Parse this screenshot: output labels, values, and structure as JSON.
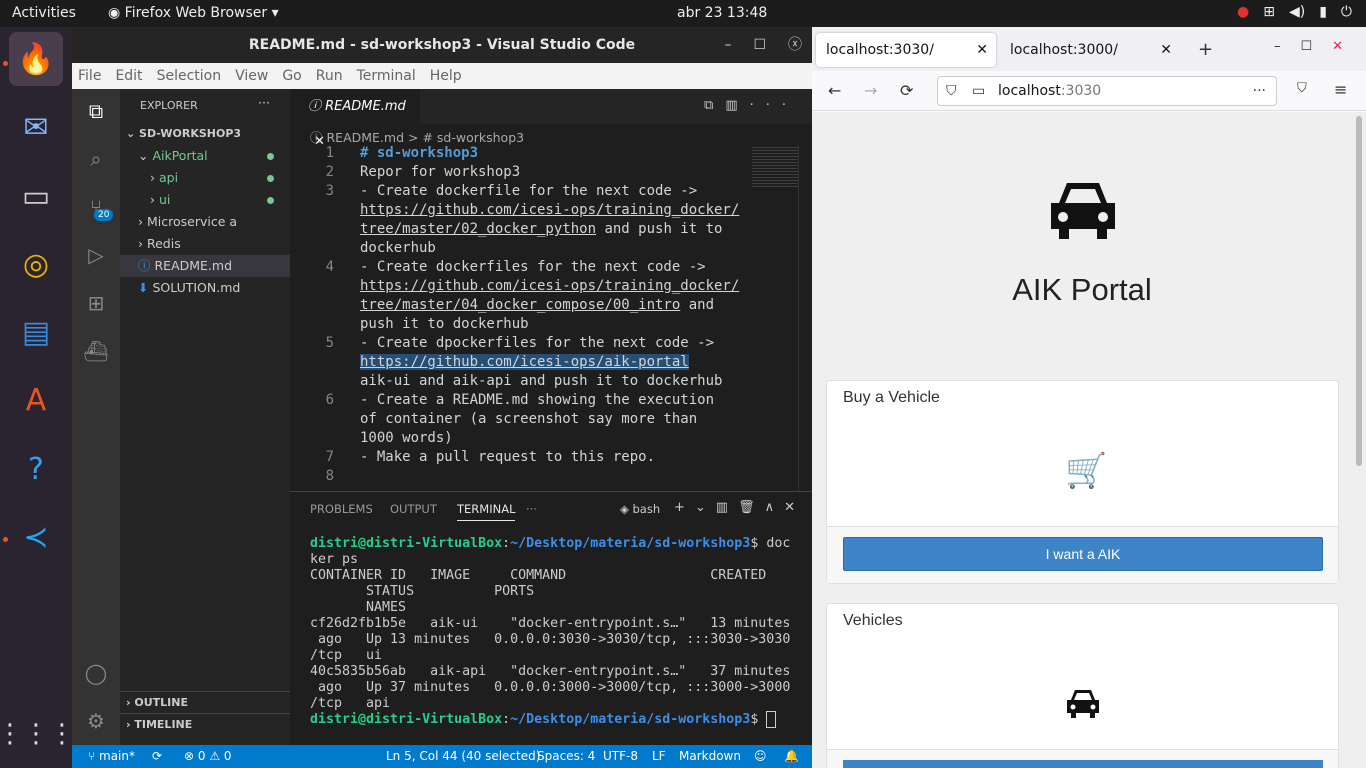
{
  "topbar": {
    "activities": "Activities",
    "app": "Firefox Web Browser",
    "clock": "abr 23  13:48"
  },
  "vscode": {
    "title": "README.md - sd-workshop3 - Visual Studio Code",
    "menu": [
      "File",
      "Edit",
      "Selection",
      "View",
      "Go",
      "Run",
      "Terminal",
      "Help"
    ],
    "scm_badge": "20",
    "explorer": {
      "header": "EXPLORER",
      "root": "SD-WORKSHOP3",
      "items": [
        {
          "label": "AikPortal",
          "indent": 1,
          "caret": "⌄",
          "mod": true,
          "color": "#73c991"
        },
        {
          "label": "api",
          "indent": 2,
          "caret": "›",
          "mod": true,
          "color": "#73c991"
        },
        {
          "label": "ui",
          "indent": 2,
          "caret": "›",
          "mod": true,
          "color": "#73c991"
        },
        {
          "label": "Microservice a",
          "indent": 1,
          "caret": "›",
          "mod": false,
          "color": "#ccc"
        },
        {
          "label": "Redis",
          "indent": 1,
          "caret": "›",
          "mod": false,
          "color": "#ccc"
        },
        {
          "label": "README.md",
          "indent": 1,
          "caret": "ⓘ",
          "mod": false,
          "color": "#ccc",
          "selected": true
        },
        {
          "label": "SOLUTION.md",
          "indent": 1,
          "caret": "⬇",
          "mod": false,
          "color": "#ccc"
        }
      ],
      "outline": "OUTLINE",
      "timeline": "TIMELINE"
    },
    "tab": "README.md",
    "breadcrumb": [
      "README.md",
      ">",
      "# sd-workshop3"
    ],
    "lines": [
      {
        "n": "1",
        "t": "# sd-workshop3",
        "head": true
      },
      {
        "n": "2",
        "t": "Repor for workshop3"
      },
      {
        "n": "3",
        "t": "- Create dockerfile for the next code ->"
      },
      {
        "n": "",
        "t": "https://github.com/icesi-ops/training_docker/",
        "u": true
      },
      {
        "n": "",
        "t": "tree/master/02_docker_python",
        "u": true,
        "rest": " and push it to"
      },
      {
        "n": "",
        "t": "dockerhub"
      },
      {
        "n": "4",
        "t": "- Create dockerfiles for the next code ->"
      },
      {
        "n": "",
        "t": "https://github.com/icesi-ops/training_docker/",
        "u": true
      },
      {
        "n": "",
        "t": "tree/master/04_docker_compose/00_intro",
        "u": true,
        "rest": " and"
      },
      {
        "n": "",
        "t": "push it to dockerhub"
      },
      {
        "n": "5",
        "t": "- Create dpockerfiles for the next code ->"
      },
      {
        "n": "",
        "t": "https://github.com/icesi-ops/aik-portal",
        "u": true,
        "sel": true
      },
      {
        "n": "",
        "t": "aik-ui and aik-api and push it to dockerhub"
      },
      {
        "n": "6",
        "t": "- Create a README.md showing the execution"
      },
      {
        "n": "",
        "t": "of container (a screenshot say more than"
      },
      {
        "n": "",
        "t": "1000 words)"
      },
      {
        "n": "7",
        "t": "- Make a pull request to this repo."
      },
      {
        "n": "8",
        "t": ""
      }
    ],
    "panel_tabs": [
      "PROBLEMS",
      "OUTPUT",
      "TERMINAL",
      "···"
    ],
    "shell": "bash",
    "terminal": {
      "prompt_user": "distri@distri-VirtualBox",
      "prompt_path": "~/Desktop/materia/sd-workshop3",
      "cmd": " doc\nker ps",
      "output": "CONTAINER ID   IMAGE     COMMAND                  CREATED\n       STATUS          PORTS\n       NAMES\ncf26d2fb1b5e   aik-ui    \"docker-entrypoint.s…\"   13 minutes\n ago   Up 13 minutes   0.0.0.0:3030->3030/tcp, :::3030->3030\n/tcp   ui\n40c5835b56ab   aik-api   \"docker-entrypoint.s…\"   37 minutes\n ago   Up 37 minutes   0.0.0.0:3000->3000/tcp, :::3000->3000\n/tcp   api"
    },
    "status": {
      "branch": "main*",
      "problems": "⊗ 0 ⚠ 0",
      "pos": "Ln 5, Col 44 (40 selected)",
      "spaces": "Spaces: 4",
      "enc": "UTF-8",
      "eol": "LF",
      "lang": "Markdown"
    }
  },
  "firefox": {
    "tabs": [
      "localhost:3030/",
      "localhost:3000/"
    ],
    "url_host": "localhost",
    "url_port": ":3030",
    "page": {
      "title": "AIK Portal",
      "card1": "Buy a Vehicle",
      "button1": "I want a AIK",
      "card2": "Vehicles"
    }
  }
}
